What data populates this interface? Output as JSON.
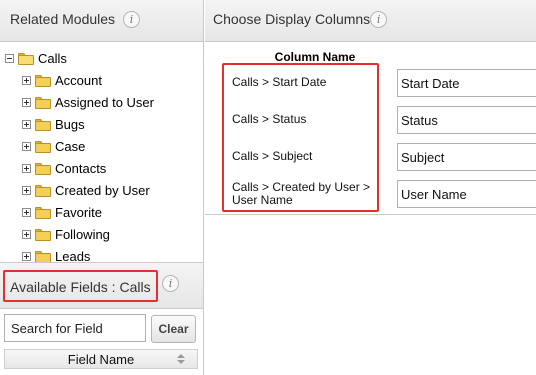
{
  "related_modules": {
    "title": "Related Modules",
    "info_icon": "i",
    "tree": {
      "root": "Calls",
      "items": [
        "Account",
        "Assigned to User",
        "Bugs",
        "Case",
        "Contacts",
        "Created by User",
        "Favorite",
        "Following",
        "Leads"
      ]
    }
  },
  "available_fields": {
    "title": "Available Fields : Calls",
    "info_icon": "i",
    "search_placeholder": "Search for Field",
    "clear_label": "Clear",
    "column_header": "Field Name"
  },
  "display_columns": {
    "title": "Choose Display Columns",
    "info_icon": "i",
    "column_header": "Column Name",
    "rows": [
      {
        "path": "Calls > Start Date",
        "value": "Start Date"
      },
      {
        "path": "Calls > Status",
        "value": "Status"
      },
      {
        "path": "Calls > Subject",
        "value": "Subject"
      },
      {
        "path": "Calls > Created by User > User Name",
        "value": "User Name"
      }
    ]
  },
  "colors": {
    "highlight": "#e3302f",
    "folder": "#f3cf55"
  }
}
